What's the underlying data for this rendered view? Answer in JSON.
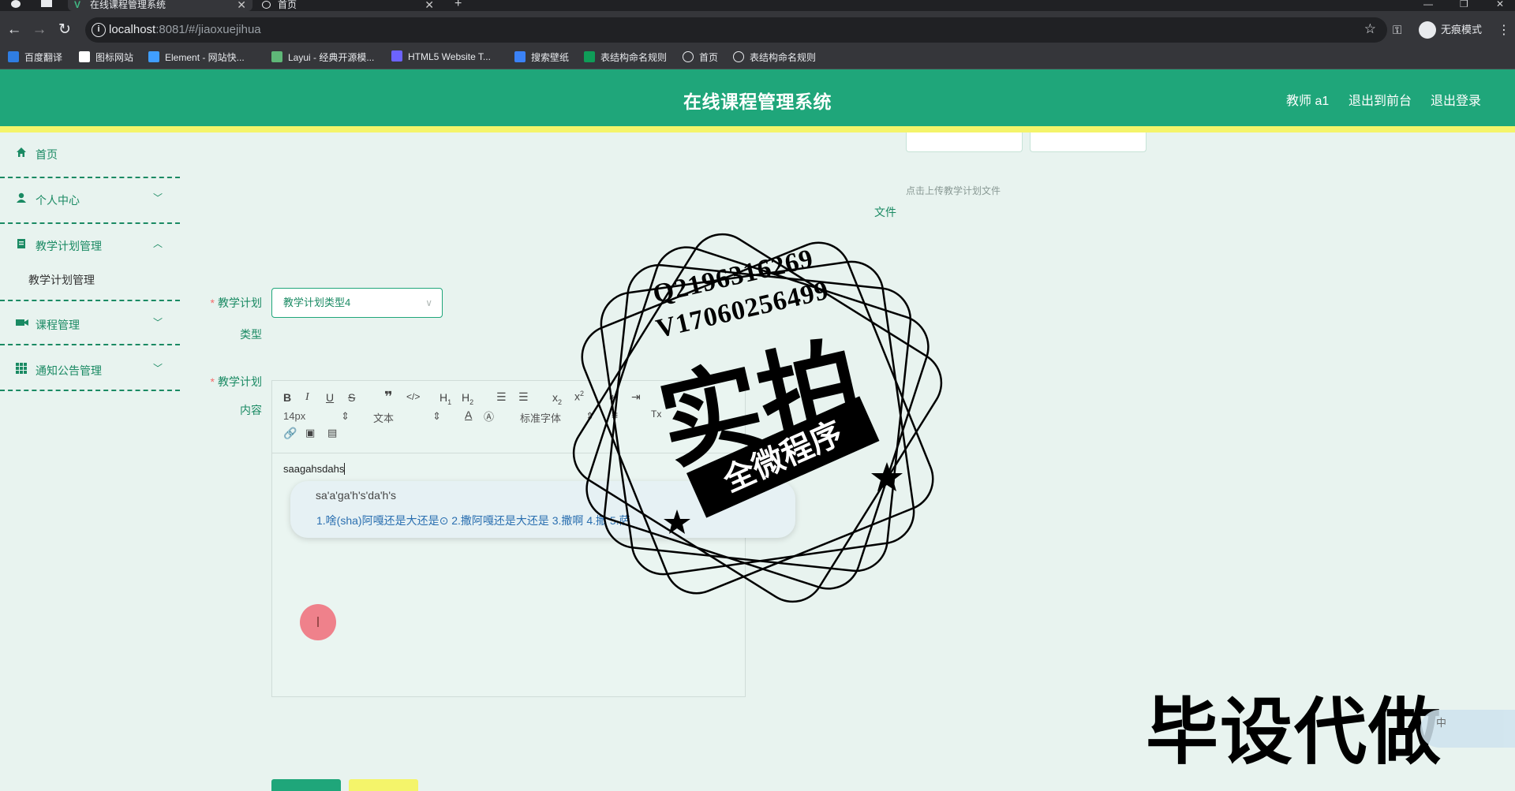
{
  "browser": {
    "tabs": [
      {
        "title": "在线课程管理系统",
        "active": true
      },
      {
        "title": "首页",
        "active": false
      }
    ],
    "new_tab_symbol": "+",
    "url_host": "localhost",
    "url_rest": ":8081/#/jiaoxuejihua",
    "profile_label": "无痕模式",
    "bookmarks": [
      {
        "label": "百度翻译",
        "icon": "baidu-translate-icon",
        "color": "#2f7de1"
      },
      {
        "label": "图标网站",
        "icon": "flag-icon",
        "color": "#ffffff"
      },
      {
        "label": "Element - 网站快...",
        "icon": "element-icon",
        "color": "#409eff"
      },
      {
        "label": "Layui - 经典开源模...",
        "icon": "layui-icon",
        "color": "#5fb878"
      },
      {
        "label": "HTML5 Website T...",
        "icon": "html5-icon",
        "color": "#6c63ff"
      },
      {
        "label": "搜索壁纸",
        "icon": "wallpaper-icon",
        "color": "#3b82f6"
      },
      {
        "label": "表结构命名规则",
        "icon": "sheets-icon",
        "color": "#0f9d58"
      },
      {
        "label": "首页",
        "icon": "globe-icon",
        "color": "#e8eaed"
      },
      {
        "label": "表结构命名规则",
        "icon": "globe-icon",
        "color": "#e8eaed"
      }
    ]
  },
  "header": {
    "title": "在线课程管理系统",
    "links": [
      "教师 a1",
      "退出到前台",
      "退出登录"
    ],
    "color": "#1fa67a"
  },
  "sidebar": {
    "items": [
      {
        "label": "首页",
        "icon": "home-icon",
        "expandable": false
      },
      {
        "label": "个人中心",
        "icon": "user-icon",
        "expandable": true
      },
      {
        "label": "教学计划管理",
        "icon": "document-icon",
        "expandable": true,
        "expanded": true
      },
      {
        "label": "课程管理",
        "icon": "video-icon",
        "expandable": true
      },
      {
        "label": "通知公告管理",
        "icon": "grid-icon",
        "expandable": true
      }
    ],
    "sub_items": [
      "教学计划管理"
    ]
  },
  "form": {
    "upload_hint": "点击上传教学计划文件",
    "file_label": "文件",
    "type_label_1": "教学计划",
    "type_label_2": "类型",
    "type_value": "教学计划类型4",
    "content_label_1": "教学计划",
    "content_label_2": "内容",
    "font_size": "14px",
    "block_format": "文本",
    "font_family": "标准字体",
    "editor_text": "saagahsdahs",
    "required_mark": "*"
  },
  "ime": {
    "composition": "sa'a'ga'h's'da'h's",
    "candidates": "1.啥(sha)阿嘎还是大还是⊙    2.撒阿嘎还是大还是    3.撒啊    4.撒    5.萨"
  },
  "watermark": {
    "qq": "Q2196316269",
    "vx": "V17060256499",
    "big": "实拍",
    "banner": "全微程序",
    "corner": "毕设代做",
    "ime_float": "中"
  }
}
